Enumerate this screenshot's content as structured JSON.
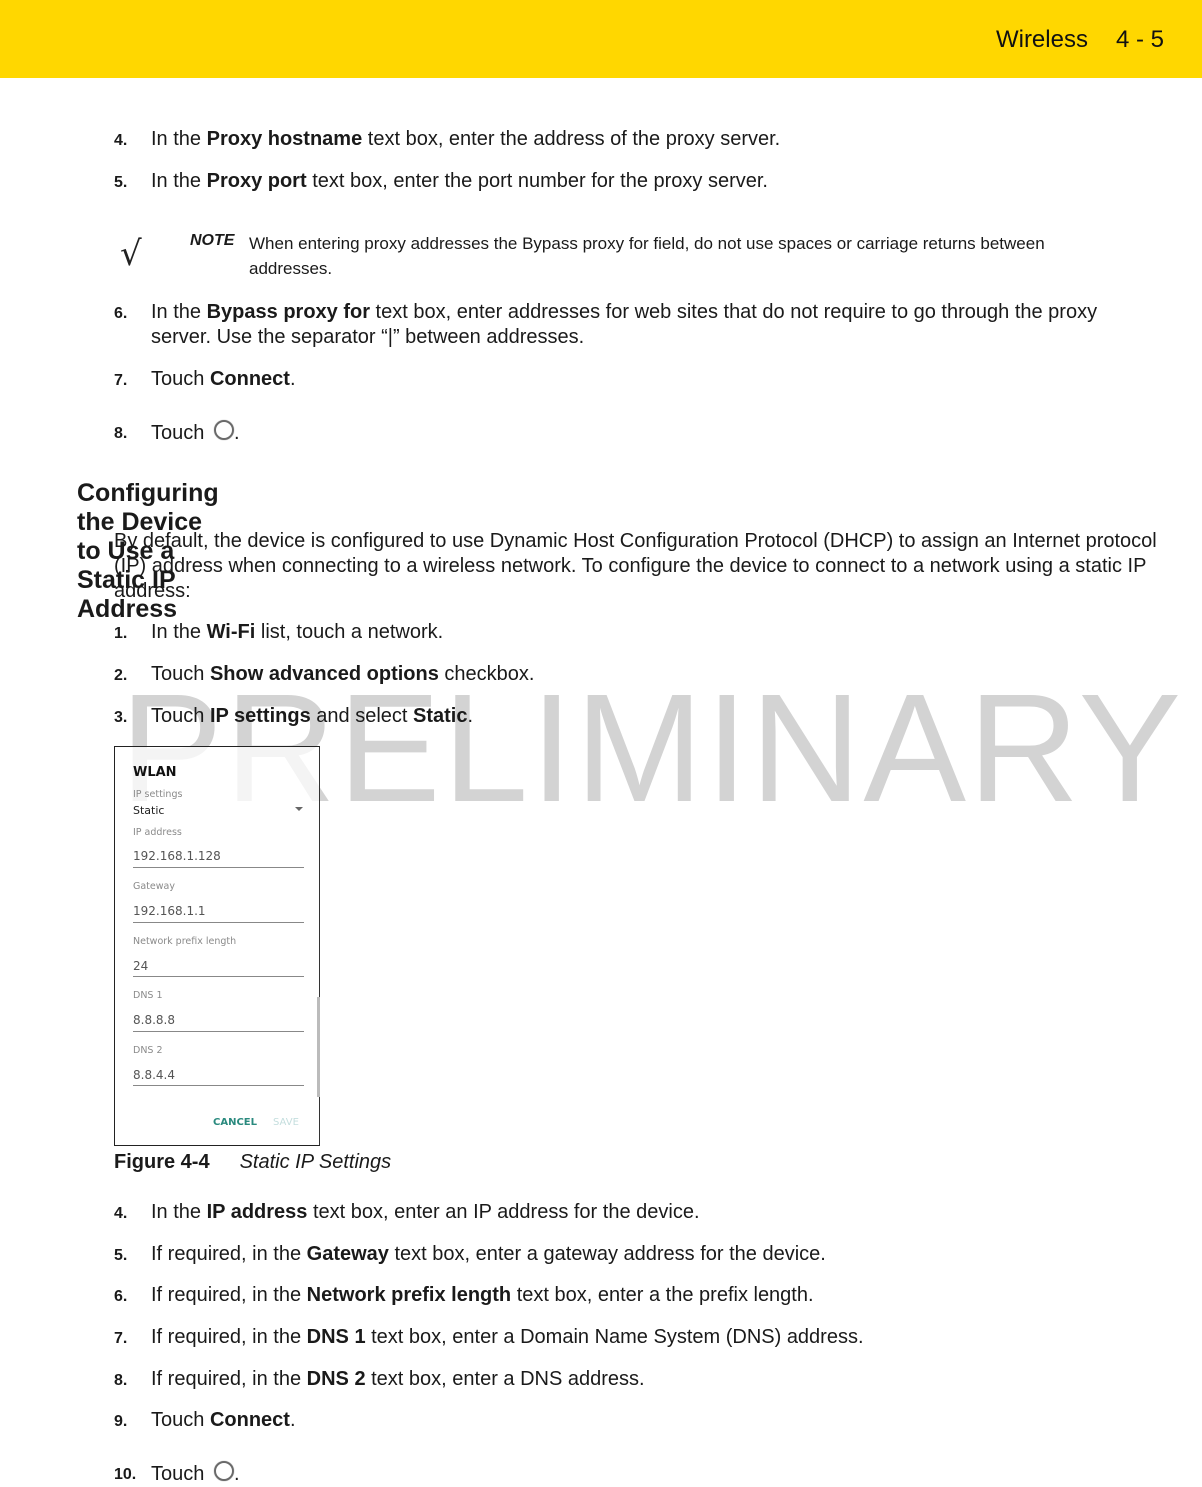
{
  "header": {
    "section": "Wireless",
    "page": "4 - 5",
    "accent_color": "#ffd700"
  },
  "steps_top": [
    {
      "num": "4.",
      "pre": "In the ",
      "bold": "Proxy hostname",
      "post": " text box, enter the address of the proxy server."
    },
    {
      "num": "5.",
      "pre": "In the ",
      "bold": "Proxy port",
      "post": " text box, enter the port number for the proxy server."
    }
  ],
  "note": {
    "icon": "checkmark-icon",
    "label": "NOTE",
    "text": "When entering proxy addresses the Bypass proxy for field, do not use spaces or carriage returns between addresses."
  },
  "steps_mid": [
    {
      "num": "6.",
      "pre": "In the ",
      "bold": "Bypass proxy for",
      "post": " text box, enter addresses for web sites that do not require to go through the proxy server. Use the separator “|” between addresses."
    },
    {
      "num": "7.",
      "pre": "Touch ",
      "bold": "Connect",
      "post": "."
    },
    {
      "num": "8.",
      "pre": "Touch ",
      "icon": "circle-home-icon",
      "post": "."
    }
  ],
  "section": {
    "title": "Configuring the Device to Use a Static IP Address",
    "intro": "By default, the device is configured to use Dynamic Host Configuration Protocol (DHCP) to assign an Internet protocol (IP) address when connecting to a wireless network. To configure the device to connect to a network using a static IP address:"
  },
  "steps_static_a": [
    {
      "num": "1.",
      "pre": "In the ",
      "bold": "Wi-Fi",
      "post": " list, touch a network."
    },
    {
      "num": "2.",
      "pre": "Touch ",
      "bold": "Show advanced options",
      "post": " checkbox."
    },
    {
      "num": "3.",
      "pre": "Touch ",
      "bold": "IP settings",
      "mid": " and select ",
      "bold2": "Static",
      "post": "."
    }
  ],
  "watermark": "PRELIMINARY",
  "figure": {
    "title": "WLAN",
    "ip_settings_label": "IP settings",
    "ip_settings_value": "Static",
    "fields": [
      {
        "label": "IP address",
        "value": "192.168.1.128"
      },
      {
        "label": "Gateway",
        "value": "192.168.1.1"
      },
      {
        "label": "Network prefix length",
        "value": "24"
      },
      {
        "label": "DNS 1",
        "value": "8.8.8.8"
      },
      {
        "label": "DNS 2",
        "value": "8.8.4.4"
      }
    ],
    "cancel": "CANCEL",
    "save": "SAVE",
    "accent_color": "#2a8a7e"
  },
  "caption": {
    "number": "Figure 4-4",
    "title": "Static IP Settings"
  },
  "steps_static_b": [
    {
      "num": "4.",
      "pre": "In the ",
      "bold": "IP address",
      "post": " text box, enter an IP address for the device."
    },
    {
      "num": "5.",
      "pre": "If required, in the ",
      "bold": "Gateway",
      "post": " text box, enter a gateway address for the device."
    },
    {
      "num": "6.",
      "pre": "If required, in the ",
      "bold": "Network prefix length",
      "post": " text box, enter a the prefix length."
    },
    {
      "num": "7.",
      "pre": "If required, in the ",
      "bold": "DNS 1",
      "post": " text box, enter a Domain Name System (DNS) address."
    },
    {
      "num": "8.",
      "pre": "If required, in the ",
      "bold": "DNS 2",
      "post": " text box, enter a DNS address."
    },
    {
      "num": "9.",
      "pre": "Touch ",
      "bold": "Connect",
      "post": "."
    },
    {
      "num": "10.",
      "pre": "Touch ",
      "icon": "circle-home-icon",
      "post": "."
    }
  ]
}
